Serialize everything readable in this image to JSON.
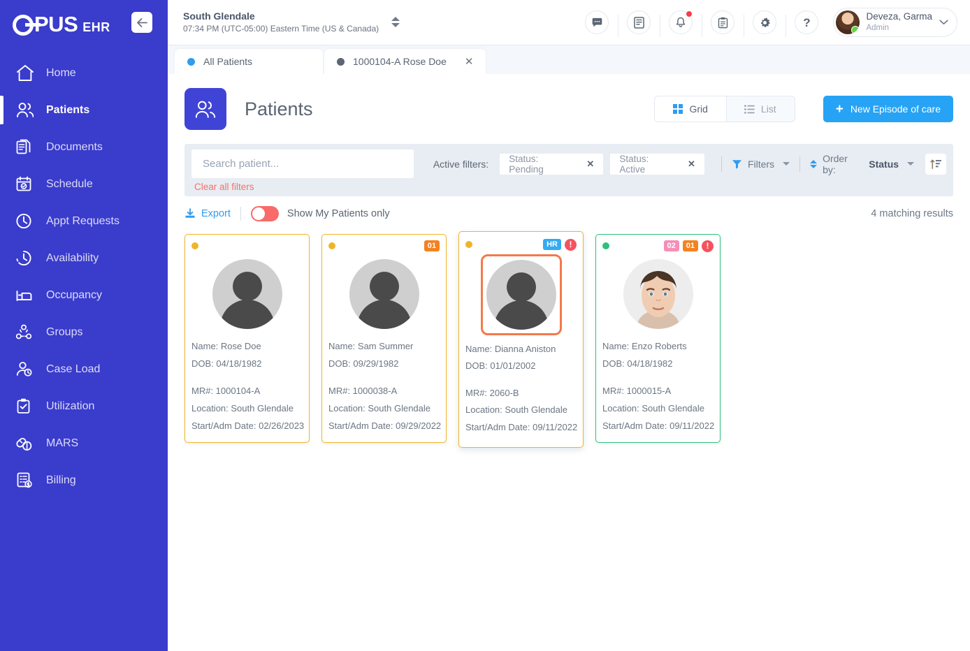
{
  "brand": {
    "o": "O",
    "pus": "PUS",
    "ehr": "EHR",
    "collapse_icon": "arrow-left-icon"
  },
  "sidebar": {
    "items": [
      {
        "label": "Home",
        "icon": "home-icon",
        "active": false
      },
      {
        "label": "Patients",
        "icon": "patients-icon",
        "active": true
      },
      {
        "label": "Documents",
        "icon": "documents-icon",
        "active": false
      },
      {
        "label": "Schedule",
        "icon": "calendar-check-icon",
        "active": false
      },
      {
        "label": "Appt Requests",
        "icon": "clock-icon",
        "active": false
      },
      {
        "label": "Availability",
        "icon": "clock-dashed-icon",
        "active": false
      },
      {
        "label": "Occupancy",
        "icon": "bed-icon",
        "active": false
      },
      {
        "label": "Groups",
        "icon": "groups-icon",
        "active": false
      },
      {
        "label": "Case Load",
        "icon": "case-load-icon",
        "active": false
      },
      {
        "label": "Utilization",
        "icon": "clipboard-check-icon",
        "active": false
      },
      {
        "label": "MARS",
        "icon": "pills-icon",
        "active": false
      },
      {
        "label": "Billing",
        "icon": "billing-icon",
        "active": false
      }
    ]
  },
  "topbar": {
    "location_name": "South Glendale",
    "location_time": "07:34 PM (UTC-05:00) Eastern Time (US & Canada)",
    "icons": [
      {
        "name": "chat-icon",
        "badge": false
      },
      {
        "name": "book-icon",
        "badge": false
      },
      {
        "name": "bell-icon",
        "badge": true
      },
      {
        "name": "clipboard-icon",
        "badge": false
      },
      {
        "name": "gear-icon",
        "badge": false
      },
      {
        "name": "help-icon",
        "badge": false
      }
    ],
    "user": {
      "name": "Deveza, Garma",
      "role": "Admin",
      "status": "online"
    }
  },
  "tabs": [
    {
      "label": "All Patients",
      "dot_color": "#2f9cf0",
      "active": true,
      "closable": false
    },
    {
      "label": "1000104-A Rose Doe",
      "dot_color": "#5b6573",
      "active": false,
      "closable": true,
      "close_glyph": "✕"
    }
  ],
  "page": {
    "title": "Patients",
    "icon": "patients-icon",
    "view_toggle": [
      {
        "label": "Grid",
        "icon": "grid-icon",
        "active": true
      },
      {
        "label": "List",
        "icon": "list-icon",
        "active": false
      }
    ],
    "new_episode_button": {
      "label": "New Episode of care",
      "plus": "+"
    }
  },
  "filters": {
    "search_placeholder": "Search patient...",
    "search_value": "",
    "active_filters_label": "Active filters:",
    "chips": [
      {
        "label": "Status: Pending",
        "remove_glyph": "✕"
      },
      {
        "label": "Status: Active",
        "remove_glyph": "✕"
      }
    ],
    "filters_button": "Filters",
    "order_by_prefix": "Order by:",
    "order_by_value": "Status",
    "sort_icon": "sort-ascending-icon",
    "clear_all": "Clear all filters"
  },
  "toolbar": {
    "export_label": "Export",
    "export_icon": "download-icon",
    "my_patients_toggle_label": "Show My Patients only",
    "my_patients_toggle_on": false,
    "results_text": "4 matching results"
  },
  "colors": {
    "brand_blue": "#3a3ccc",
    "accent_blue": "#27a3f5",
    "status_pending": "#f0b429",
    "status_active": "#2ec07d",
    "alert_red": "#f4525f",
    "hr_badge": "#34aaf2",
    "badge_orange": "#f58220",
    "badge_pink": "#f48fb8",
    "selected_outline": "#f4794a",
    "clear_link": "#fa7066"
  },
  "cards": [
    {
      "name_label": "Name: Rose Doe",
      "dob_label": "DOB: 04/18/1982",
      "mr_label": "MR#: 1000104-A",
      "location_label": "Location: South Glendale",
      "start_label": "Start/Adm Date: 02/26/2023",
      "status_dot": "#f0b429",
      "border": "#f0b429",
      "avatar": "placeholder",
      "avatar_selected": false,
      "elevated": false,
      "badges": []
    },
    {
      "name_label": "Name: Sam Summer",
      "dob_label": "DOB: 09/29/1982",
      "mr_label": "MR#: 1000038-A",
      "location_label": "Location: South Glendale",
      "start_label": "Start/Adm Date: 09/29/2022",
      "status_dot": "#f0b429",
      "border": "#f0b429",
      "avatar": "placeholder",
      "avatar_selected": false,
      "elevated": false,
      "badges": [
        {
          "text": "01",
          "color": "#f58220",
          "type": "count"
        }
      ]
    },
    {
      "name_label": "Name: Dianna Aniston",
      "dob_label": "DOB: 01/01/2002",
      "mr_label": "MR#: 2060-B",
      "location_label": "Location: South Glendale",
      "start_label": "Start/Adm Date: 09/11/2022",
      "status_dot": "#f0b429",
      "border": "#f0b429",
      "avatar": "placeholder",
      "avatar_selected": true,
      "elevated": true,
      "badges": [
        {
          "text": "HR",
          "color": "#34aaf2",
          "type": "label"
        },
        {
          "text": "!",
          "color": "#f4525f",
          "type": "alert"
        }
      ]
    },
    {
      "name_label": "Name: Enzo Roberts",
      "dob_label": "DOB: 04/18/1982",
      "mr_label": "MR#: 1000015-A",
      "location_label": "Location: South Glendale",
      "start_label": "Start/Adm Date: 09/11/2022",
      "status_dot": "#2ec07d",
      "border": "#2ec07d",
      "avatar": "photo",
      "avatar_selected": false,
      "elevated": false,
      "badges": [
        {
          "text": "02",
          "color": "#f48fb8",
          "type": "count"
        },
        {
          "text": "01",
          "color": "#f58220",
          "type": "count"
        },
        {
          "text": "!",
          "color": "#f4525f",
          "type": "alert"
        }
      ]
    }
  ]
}
